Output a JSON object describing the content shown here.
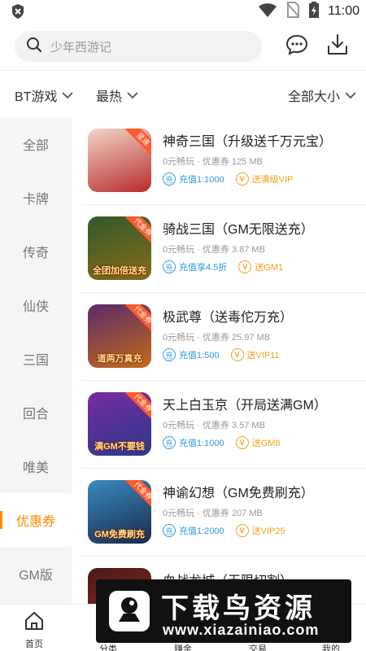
{
  "status_bar": {
    "time": "11:00",
    "icons": [
      "app-notification-icon",
      "wifi-icon",
      "no-sim-icon",
      "battery-charging-icon"
    ]
  },
  "search": {
    "placeholder": "少年西游记",
    "icon": "search-icon"
  },
  "header_actions": [
    "message-icon",
    "download-icon"
  ],
  "filters": {
    "category": "BT游戏",
    "sort": "最热",
    "size": "全部大小"
  },
  "sidebar": {
    "items": [
      {
        "label": "全部"
      },
      {
        "label": "卡牌"
      },
      {
        "label": "传奇"
      },
      {
        "label": "仙侠"
      },
      {
        "label": "三国"
      },
      {
        "label": "回合"
      },
      {
        "label": "唯美"
      },
      {
        "label": "优惠券",
        "active": true
      },
      {
        "label": "GM版"
      }
    ]
  },
  "games": [
    {
      "title": "神奇三国（升级送千万元宝）",
      "meta": "0元畅玩 · 优惠券   125 MB",
      "tag1_icon": "充",
      "tag1": "充值1:1000",
      "tag2_icon": "V",
      "tag2": "送满级VIP",
      "corner": "星速",
      "caption": "",
      "colors": [
        "#f2d6c8",
        "#b92b2b"
      ]
    },
    {
      "title": "骑战三国（GM无限送充）",
      "meta": "0元畅玩 · 优惠券   3.87 MB",
      "tag1_icon": "充",
      "tag1": "充值享4.5折",
      "tag2_icon": "V",
      "tag2": "送GM1",
      "corner": "代金券",
      "caption": "全团加倍送充",
      "colors": [
        "#2f5a2a",
        "#8a6a1a"
      ]
    },
    {
      "title": "极武尊（送毒佗万充）",
      "meta": "0元畅玩 · 优惠券   25.97 MB",
      "tag1_icon": "充",
      "tag1": "充值1:500",
      "tag2_icon": "V",
      "tag2": "送VIP11",
      "corner": "代金券",
      "caption": "道两万真充",
      "colors": [
        "#5a2a6a",
        "#c46a1a"
      ]
    },
    {
      "title": "天上白玉京（开局送满GM）",
      "meta": "0元畅玩 · 优惠券   3.57 MB",
      "tag1_icon": "充",
      "tag1": "充值1:1000",
      "tag2_icon": "V",
      "tag2": "送GM8",
      "corner": "代金券",
      "caption": "满GM不要钱",
      "colors": [
        "#7a2aa0",
        "#2a3a8a"
      ]
    },
    {
      "title": "神谕幻想（GM免费刷充）",
      "meta": "0元畅玩 · 优惠券   207 MB",
      "tag1_icon": "充",
      "tag1": "充值1:2000",
      "tag2_icon": "V",
      "tag2": "送VIP25",
      "corner": "代金券",
      "caption": "GM免费刷充",
      "colors": [
        "#3a8ac0",
        "#1a2a4a"
      ]
    },
    {
      "title": "血战龙城（无限切割）",
      "meta": "",
      "tag1_icon": "",
      "tag1": "",
      "tag2_icon": "",
      "tag2": "",
      "corner": "",
      "caption": "",
      "colors": [
        "#4a1a1a",
        "#9a2a1a"
      ]
    }
  ],
  "bottom_nav": [
    {
      "label": "首页",
      "icon": "home-icon"
    },
    {
      "label": "分类",
      "icon": "category-icon"
    },
    {
      "label": "赚金",
      "icon": "coin-icon"
    },
    {
      "label": "交易",
      "icon": "trade-icon"
    },
    {
      "label": "我的",
      "icon": "user-icon"
    }
  ],
  "watermark": {
    "main": "下载鸟资源",
    "sub": "www.xiazainiao.com"
  }
}
